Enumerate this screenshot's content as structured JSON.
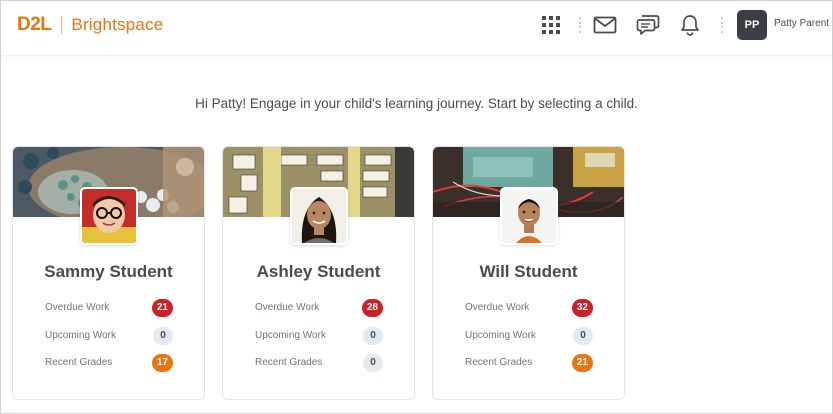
{
  "header": {
    "logo_mark": "D2L",
    "logo_name": "Brightspace",
    "user_initials": "PP",
    "user_name": "Patty Parent",
    "icons": [
      "apps-grid-icon",
      "mail-icon",
      "chat-icon",
      "bell-icon"
    ]
  },
  "greeting": "Hi Patty! Engage in your child's learning journey. Start by selecting a child.",
  "colors": {
    "brand": "#e87511",
    "overdue": "#cd2026",
    "recent": "#e87511",
    "neutral_badge": "#e3e9f1"
  },
  "children": [
    {
      "name": "Sammy Student",
      "stats": [
        {
          "label": "Overdue Work",
          "value": "21",
          "kind": "overdue"
        },
        {
          "label": "Upcoming Work",
          "value": "0",
          "kind": "neutral"
        },
        {
          "label": "Recent Grades",
          "value": "17",
          "kind": "recent"
        }
      ]
    },
    {
      "name": "Ashley Student",
      "stats": [
        {
          "label": "Overdue Work",
          "value": "28",
          "kind": "overdue"
        },
        {
          "label": "Upcoming Work",
          "value": "0",
          "kind": "neutral"
        },
        {
          "label": "Recent Grades",
          "value": "0",
          "kind": "neutral"
        }
      ]
    },
    {
      "name": "Will Student",
      "stats": [
        {
          "label": "Overdue Work",
          "value": "32",
          "kind": "overdue"
        },
        {
          "label": "Upcoming Work",
          "value": "0",
          "kind": "neutral"
        },
        {
          "label": "Recent Grades",
          "value": "21",
          "kind": "recent"
        }
      ]
    }
  ]
}
